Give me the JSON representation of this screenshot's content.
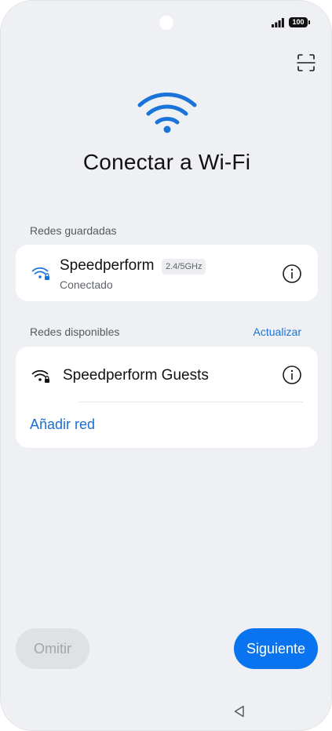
{
  "status_bar": {
    "battery": "100",
    "icons": [
      "signal-icon",
      "battery-icon"
    ]
  },
  "header": {
    "title": "Conectar a Wi-Fi",
    "scan_icon": "qr-scan-icon",
    "hero_icon": "wifi-icon"
  },
  "saved_networks": {
    "label": "Redes guardadas",
    "items": [
      {
        "name": "Speedperform",
        "band": "2.4/5GHz",
        "status": "Conectado",
        "icon": "wifi-lock-icon",
        "info_icon": "info-icon"
      }
    ]
  },
  "available_networks": {
    "label": "Redes disponibles",
    "refresh": "Actualizar",
    "items": [
      {
        "name": "Speedperform Guests",
        "icon": "wifi-lock-icon",
        "info_icon": "info-icon"
      }
    ],
    "add_network": "Añadir red"
  },
  "footer": {
    "skip": "Omitir",
    "next": "Siguiente"
  },
  "colors": {
    "accent": "#0a74f0",
    "link": "#1a6fd1",
    "background": "#eef0f3",
    "card": "#ffffff"
  }
}
